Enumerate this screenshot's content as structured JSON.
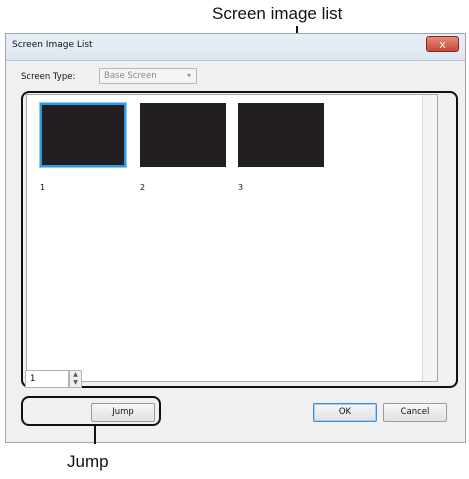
{
  "annotations": {
    "top": "Screen image list",
    "bottom": "Jump"
  },
  "window": {
    "title": "Screen Image List",
    "close": "x"
  },
  "screen_type": {
    "label": "Screen Type:",
    "value": "Base Screen"
  },
  "thumbnails": [
    {
      "label": "1",
      "selected": true
    },
    {
      "label": "2",
      "selected": false
    },
    {
      "label": "3",
      "selected": false
    }
  ],
  "jump": {
    "value": "1",
    "button": "Jump"
  },
  "buttons": {
    "ok": "OK",
    "cancel": "Cancel"
  },
  "colors": {
    "thumbnail": "#231f20",
    "selection": "#2e9be0",
    "close": "#c44a34"
  }
}
